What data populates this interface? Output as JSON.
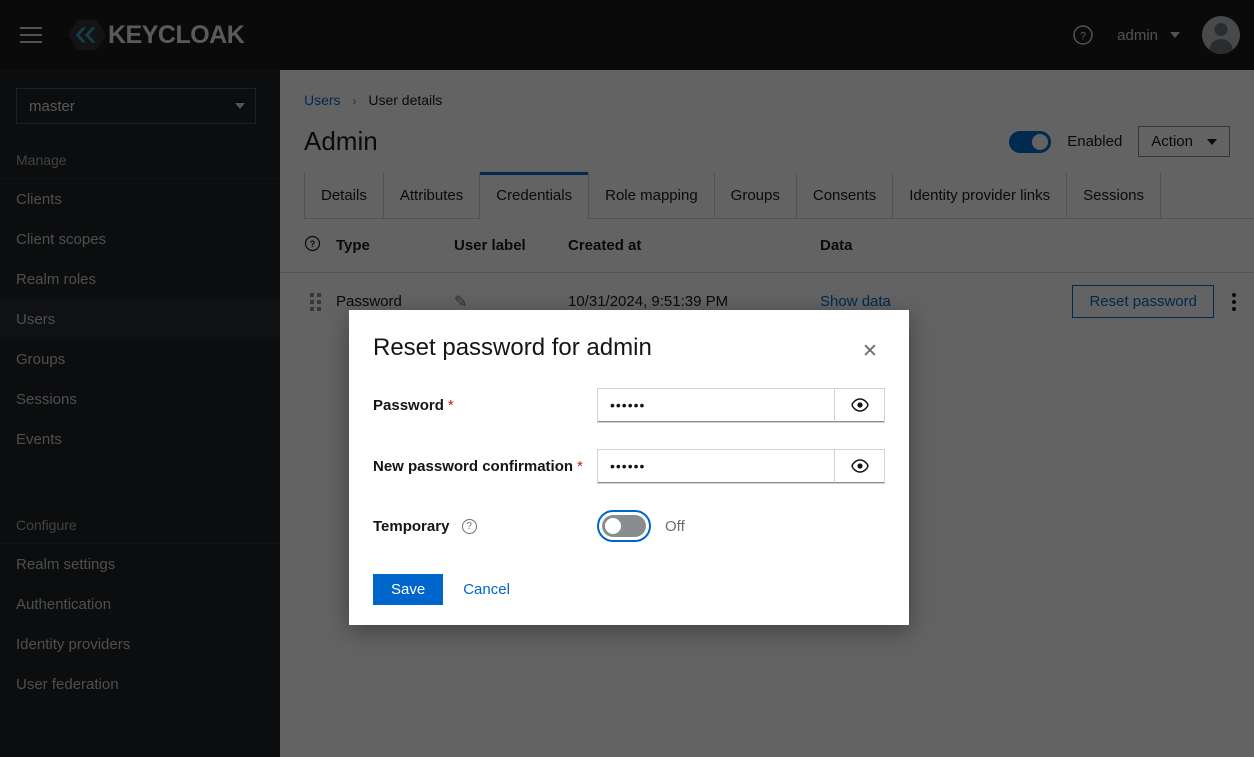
{
  "masthead": {
    "menu_icon": "hamburger-icon",
    "brand": "KEYCLOAK",
    "help_icon": "help-circle-icon",
    "username": "admin",
    "avatar_icon": "user-avatar-icon"
  },
  "sidebar": {
    "realm": "master",
    "groups": [
      {
        "title": "Manage",
        "items": [
          "Clients",
          "Client scopes",
          "Realm roles",
          "Users",
          "Groups",
          "Sessions",
          "Events"
        ]
      },
      {
        "title": "Configure",
        "items": [
          "Realm settings",
          "Authentication",
          "Identity providers",
          "User federation"
        ]
      }
    ],
    "active_item": "Users"
  },
  "breadcrumb": {
    "parent": "Users",
    "separator": "›",
    "current": "User details"
  },
  "page": {
    "title": "Admin",
    "enabled_label": "Enabled",
    "enabled_state": "on",
    "action_label": "Action"
  },
  "tabs": [
    {
      "label": "Details",
      "active": false
    },
    {
      "label": "Attributes",
      "active": false
    },
    {
      "label": "Credentials",
      "active": true
    },
    {
      "label": "Role mapping",
      "active": false
    },
    {
      "label": "Groups",
      "active": false
    },
    {
      "label": "Consents",
      "active": false
    },
    {
      "label": "Identity provider links",
      "active": false
    },
    {
      "label": "Sessions",
      "active": false
    }
  ],
  "credentials_table": {
    "columns": [
      "",
      "Type",
      "User label",
      "Created at",
      "Data",
      "",
      ""
    ],
    "rows": [
      {
        "type": "Password",
        "user_label": "",
        "created_at": "10/31/2024, 9:51:39 PM",
        "data_link": "Show data",
        "reset_button": "Reset password"
      }
    ]
  },
  "modal": {
    "title": "Reset password for admin",
    "close_icon": "close-icon",
    "fields": [
      {
        "label": "Password",
        "required": "*",
        "value": "••••••",
        "eye_icon": "eye-icon"
      },
      {
        "label": "New password confirmation",
        "required": "*",
        "value": "••••••",
        "eye_icon": "eye-icon"
      }
    ],
    "temporary": {
      "label": "Temporary",
      "help_icon": "help-circle-icon",
      "state_label": "Off",
      "state": "off"
    },
    "save_label": "Save",
    "cancel_label": "Cancel"
  },
  "colors": {
    "accent_blue": "#0066cc",
    "masthead_bg": "#151515",
    "sidebar_bg": "#1b1d21",
    "required_red": "#c9190b"
  }
}
